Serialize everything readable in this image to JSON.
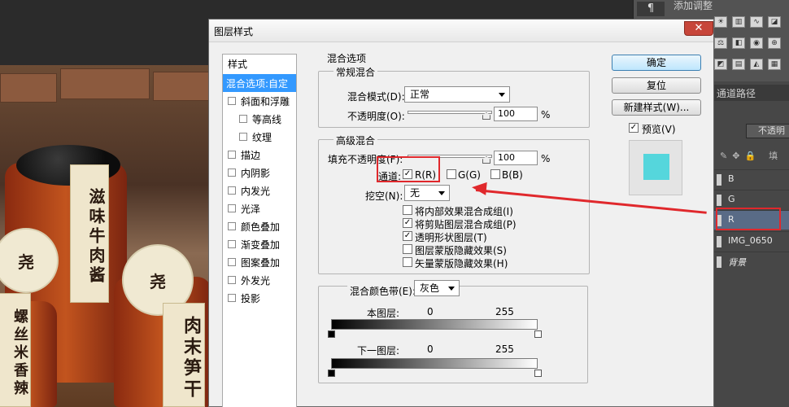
{
  "workspace": {
    "adjustments_title": "添加调整",
    "jar_label_1": "滋味牛肉酱",
    "jar_label_2": "肉末笋干",
    "jar_label_3": "螺丝米香辣",
    "jar_seal": "尧"
  },
  "layers_panel": {
    "tabs": [
      "通道",
      "路径"
    ],
    "opacity_label": "不透明",
    "fill_label": "填",
    "layers": [
      {
        "name": "B",
        "selected": false
      },
      {
        "name": "G",
        "selected": false
      },
      {
        "name": "R",
        "selected": true
      },
      {
        "name": "IMG_0650",
        "selected": false
      },
      {
        "name": "背景",
        "selected": false
      }
    ]
  },
  "dialog": {
    "title": "图层样式",
    "close_symbol": "✕",
    "style_list": {
      "header": "样式",
      "active": "混合选项:自定",
      "items": [
        {
          "label": "斜面和浮雕",
          "indent": false
        },
        {
          "label": "等高线",
          "indent": true
        },
        {
          "label": "纹理",
          "indent": true
        },
        {
          "label": "描边",
          "indent": false
        },
        {
          "label": "内阴影",
          "indent": false
        },
        {
          "label": "内发光",
          "indent": false
        },
        {
          "label": "光泽",
          "indent": false
        },
        {
          "label": "颜色叠加",
          "indent": false
        },
        {
          "label": "渐变叠加",
          "indent": false
        },
        {
          "label": "图案叠加",
          "indent": false
        },
        {
          "label": "外发光",
          "indent": false
        },
        {
          "label": "投影",
          "indent": false
        }
      ]
    },
    "blending_options": {
      "title": "混合选项",
      "general": {
        "title": "常规混合",
        "blend_mode_label": "混合模式(D):",
        "blend_mode_value": "正常",
        "opacity_label": "不透明度(O):",
        "opacity_value": "100",
        "opacity_unit": "%"
      },
      "advanced": {
        "title": "高级混合",
        "fill_opacity_label": "填充不透明度(F):",
        "fill_opacity_value": "100",
        "fill_unit": "%",
        "channels_label": "通道:",
        "channel_r": {
          "label": "R(R)",
          "checked": true
        },
        "channel_g": {
          "label": "G(G)",
          "checked": false
        },
        "channel_b": {
          "label": "B(B)",
          "checked": false
        },
        "knockout_label": "挖空(N):",
        "knockout_value": "无",
        "options": [
          {
            "label": "将内部效果混合成组(I)",
            "checked": false
          },
          {
            "label": "将剪贴图层混合成组(P)",
            "checked": true
          },
          {
            "label": "透明形状图层(T)",
            "checked": true
          },
          {
            "label": "图层蒙版隐藏效果(S)",
            "checked": false
          },
          {
            "label": "矢量蒙版隐藏效果(H)",
            "checked": false
          }
        ]
      },
      "blend_if": {
        "label": "混合颜色带(E):",
        "value": "灰色",
        "this_layer_label": "本图层:",
        "this_layer_min": "0",
        "this_layer_max": "255",
        "underlying_label": "下一图层:",
        "underlying_min": "0",
        "underlying_max": "255"
      }
    },
    "buttons": {
      "ok": "确定",
      "reset": "复位",
      "new_style": "新建样式(W)...",
      "preview_label": "预览(V)",
      "preview_checked": true
    },
    "preview_color": "#55d6dc",
    "check_glyph": "✓"
  },
  "annotation_color": "#e0282c"
}
